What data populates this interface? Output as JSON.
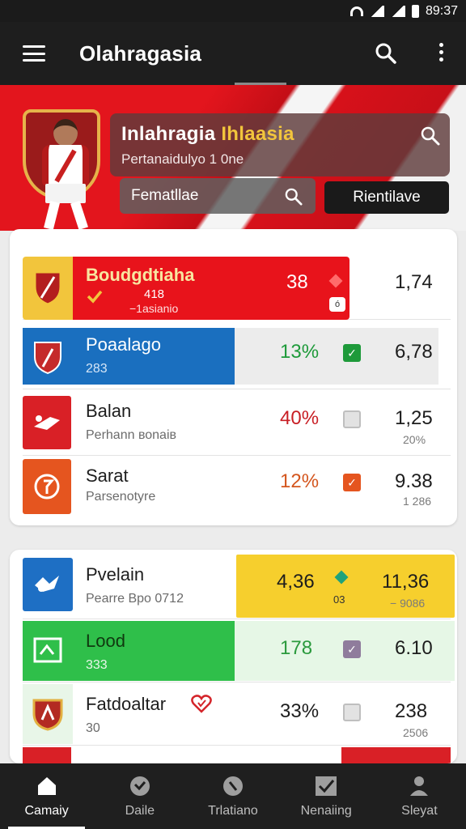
{
  "status_bar": {
    "time": "89:37"
  },
  "app_bar": {
    "title": "Olahragasia"
  },
  "hero": {
    "title_part1": "Inlahragia ",
    "title_part2": "Ihlaasia",
    "subtitle": "Pertanaidulyo 1 0ne",
    "input_value": "Fematllae",
    "button_label": "Rientilave"
  },
  "panel1": {
    "rows": [
      {
        "name": "Boudgdtiaha",
        "sub_line1": "418",
        "sub_line2": "−1asianio",
        "value": "38",
        "odds": "1,74",
        "odds_sub": ""
      },
      {
        "name": "Poaalago",
        "sub": "283",
        "pct": "13%",
        "odds": "6,78",
        "odds_sub": ""
      },
      {
        "name": "Balan",
        "sub": "Perhann воnaiʙ",
        "pct": "40%",
        "odds": "1,25",
        "odds_sub": "20%"
      },
      {
        "name": "Sarat",
        "sub": "Parsenotyre",
        "pct": "12%",
        "odds": "9.38",
        "odds_sub": "1 286"
      }
    ]
  },
  "panel2": {
    "rows": [
      {
        "name": "Pvelain",
        "sub": "Pearre Bpo 0712",
        "value": "4,36",
        "badge": "03",
        "odds": "11,36",
        "odds_sub": "− 9086"
      },
      {
        "name": "Lood",
        "sub": "333",
        "pct": "178",
        "odds": "6.10",
        "odds_sub": ""
      },
      {
        "name": "Fatdoaltar",
        "sub": "30",
        "pct": "33%",
        "odds": "238",
        "odds_sub": "2506"
      }
    ]
  },
  "bottom_nav": [
    {
      "label": "Camaiy",
      "icon": "home-icon"
    },
    {
      "label": "Daile",
      "icon": "ball-icon"
    },
    {
      "label": "Trlatiano",
      "icon": "whistle-icon"
    },
    {
      "label": "Nenaiing",
      "icon": "check-icon"
    },
    {
      "label": "Sleyat",
      "icon": "profile-icon"
    }
  ],
  "colors": {
    "brand_red": "#e3151d",
    "accent_yellow": "#f2c53c",
    "positive_green": "#1e9a3a",
    "negative_red": "#d4242a",
    "orange": "#e5551f"
  }
}
